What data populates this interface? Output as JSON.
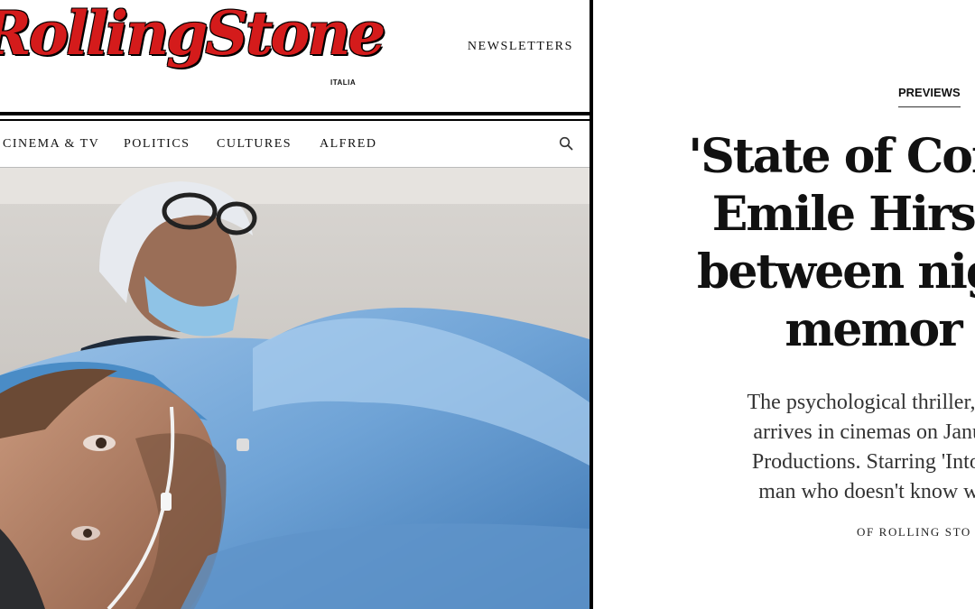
{
  "site": {
    "logo_text": "RollingStone",
    "logo_edition": "ITALIA",
    "newsletters_label": "NEWSLETTERS"
  },
  "nav": {
    "items": [
      "CINEMA & TV",
      "POLITICS",
      "CULTURES",
      "ALFRED"
    ],
    "search_icon": "search-icon"
  },
  "article": {
    "category": "PREVIEWS",
    "headline_lines": [
      "'State of Conso",
      "Emile Hirsch",
      "between night",
      "memor"
    ],
    "standfirst_lines": [
      "The psychological thriller, Mar",
      "arrives in cinemas on January",
      "Productions. Starring 'Into the",
      "man who doesn't know what"
    ],
    "byline": "OF ROLLING STO"
  },
  "colors": {
    "brand_red": "#d41b1b",
    "rule": "#000000",
    "scrub_blue": "#6fa3d6"
  }
}
